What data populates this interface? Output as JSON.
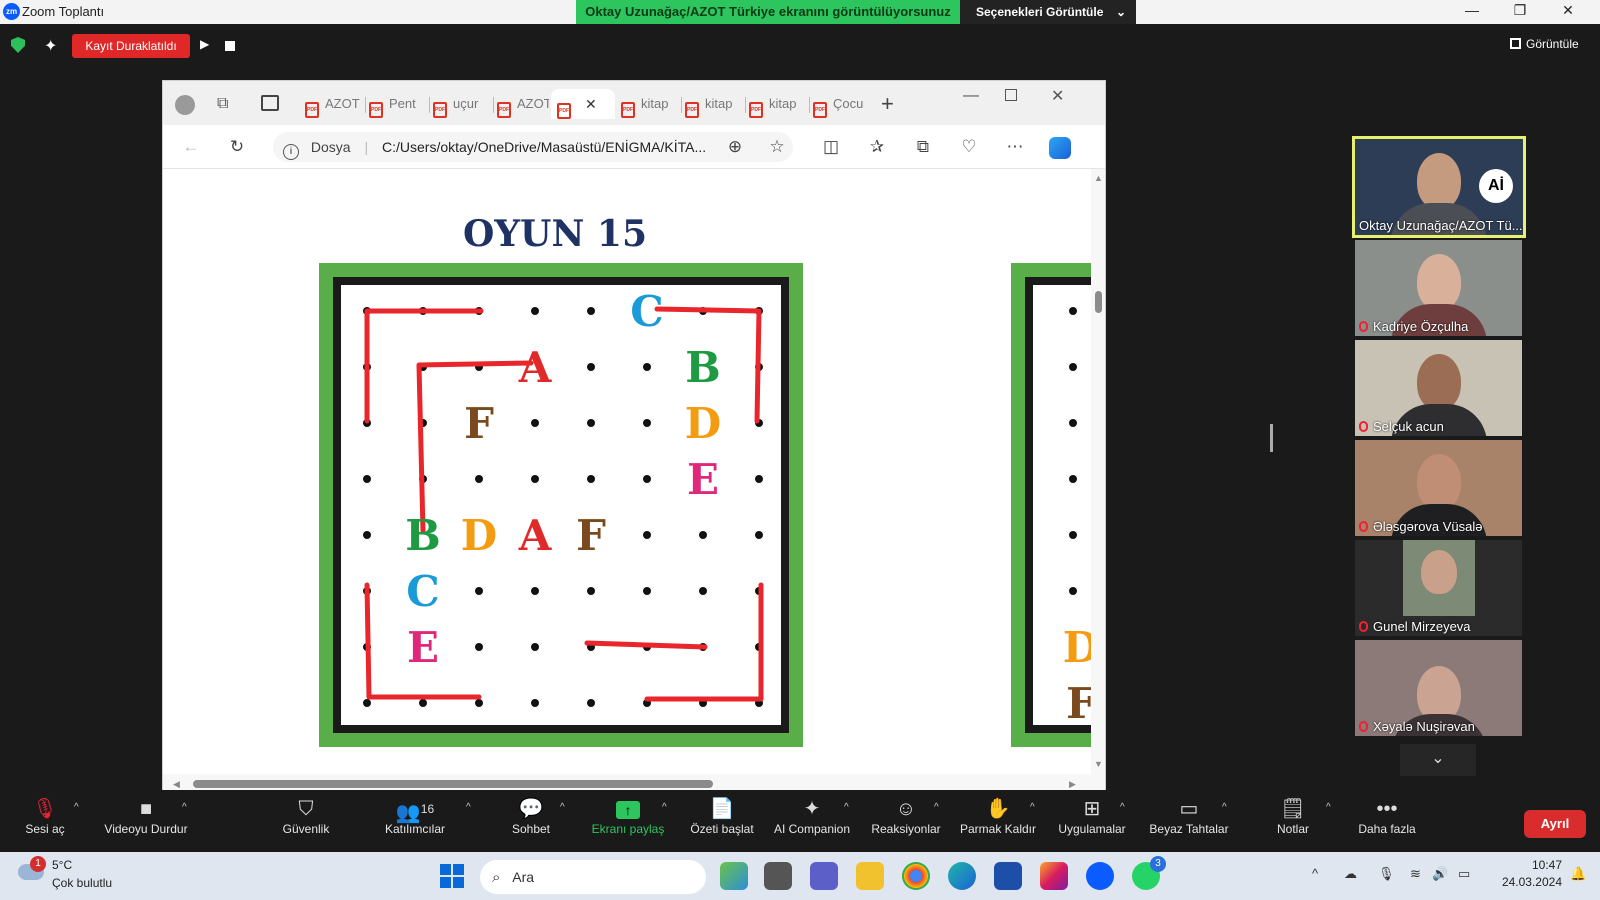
{
  "window": {
    "title": "Zoom Toplantı",
    "share_notice": "Oktay Uzunağaç/AZOT Türkiye ekranını görüntülüyorsunuz",
    "view_options": "Seçenekleri Görüntüle",
    "view_label": "Görüntüle"
  },
  "recording": {
    "status": "Kayıt Duraklatıldı"
  },
  "browser": {
    "tabs": [
      "AZOT",
      "Pent",
      "uçur",
      "AZOT",
      "",
      "kitap",
      "kitap",
      "kitap",
      "Çocu"
    ],
    "url_label": "Dosya",
    "url": "C:/Users/oktay/OneDrive/Masaüstü/ENİGMA/KİTA..."
  },
  "pdf": {
    "title": "OYUN 15",
    "grid_letters": [
      {
        "t": "C",
        "r": 0,
        "c": 5,
        "color": "#1a9ad6"
      },
      {
        "t": "A",
        "r": 1,
        "c": 3,
        "color": "#e02a2a"
      },
      {
        "t": "B",
        "r": 1,
        "c": 6,
        "color": "#1e9a43"
      },
      {
        "t": "F",
        "r": 2,
        "c": 2,
        "color": "#7a4a1e"
      },
      {
        "t": "D",
        "r": 2,
        "c": 6,
        "color": "#f39c12"
      },
      {
        "t": "E",
        "r": 3,
        "c": 6,
        "color": "#e0287a"
      },
      {
        "t": "B",
        "r": 4,
        "c": 1,
        "color": "#1e9a43"
      },
      {
        "t": "D",
        "r": 4,
        "c": 2,
        "color": "#f39c12"
      },
      {
        "t": "A",
        "r": 4,
        "c": 3,
        "color": "#e02a2a"
      },
      {
        "t": "F",
        "r": 4,
        "c": 4,
        "color": "#7a4a1e"
      },
      {
        "t": "C",
        "r": 5,
        "c": 1,
        "color": "#1a9ad6"
      },
      {
        "t": "E",
        "r": 6,
        "c": 1,
        "color": "#e0287a"
      }
    ],
    "partial_letters": [
      {
        "t": "D",
        "r": 6,
        "color": "#f39c12"
      },
      {
        "t": "F",
        "r": 7,
        "color": "#7a4a1e"
      }
    ]
  },
  "participants": [
    {
      "name": "Oktay Uzunağaç/AZOT Tü...",
      "active": true
    },
    {
      "name": "Kadriye Özçulha",
      "active": false
    },
    {
      "name": "Selçuk acun",
      "active": false
    },
    {
      "name": "Ələsgərova Vüsalə",
      "active": false
    },
    {
      "name": "Gunel Mirzeyeva",
      "active": false
    },
    {
      "name": "Xəyalə Nuşirəvan",
      "active": false
    }
  ],
  "toolbar": {
    "unmute": "Sesi aç",
    "stop_video": "Videoyu Durdur",
    "security": "Güvenlik",
    "participants": "Katılımcılar",
    "participants_count": "16",
    "chat": "Sohbet",
    "share": "Ekranı paylaş",
    "summary": "Özeti başlat",
    "ai": "AI Companion",
    "reactions": "Reaksiyonlar",
    "raise_hand": "Parmak Kaldır",
    "apps": "Uygulamalar",
    "whiteboard": "Beyaz Tahtalar",
    "notes": "Notlar",
    "more": "Daha fazla",
    "leave": "Ayrıl"
  },
  "taskbar": {
    "weather_temp": "5°C",
    "weather_desc": "Çok bulutlu",
    "weather_badge": "1",
    "search": "Ara",
    "time": "10:47",
    "date": "24.03.2024",
    "whatsapp_badge": "3"
  },
  "colors": {
    "share_green": "#2dc55e",
    "puzzle_green": "#5aae4a",
    "line_red": "#e8262b",
    "leave_red": "#d92d2d",
    "active_border": "#e9f06e"
  }
}
